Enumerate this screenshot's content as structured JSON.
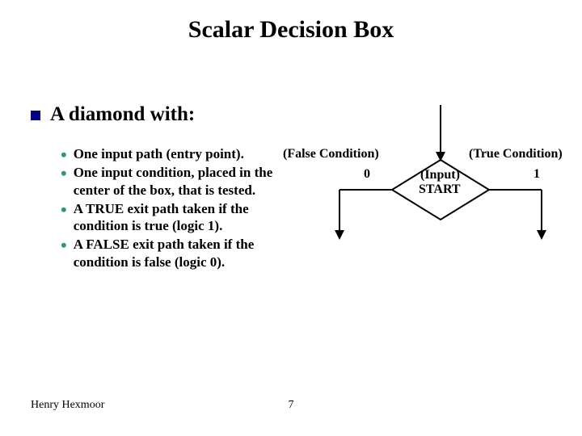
{
  "title": "Scalar Decision Box",
  "heading": "A diamond with:",
  "bullets": [
    "One input path (entry point).",
    "One input condition, placed in the center of the box, that is tested.",
    "A TRUE exit path taken if the condition is true (logic 1).",
    "A FALSE exit path taken if the condition is false (logic 0)."
  ],
  "diagram": {
    "falseCondition": "(False Condition)",
    "trueCondition": "(True Condition)",
    "zero": "0",
    "one": "1",
    "input": "(Input)",
    "start": "START"
  },
  "footer": {
    "author": "Henry Hexmoor",
    "page": "7"
  }
}
